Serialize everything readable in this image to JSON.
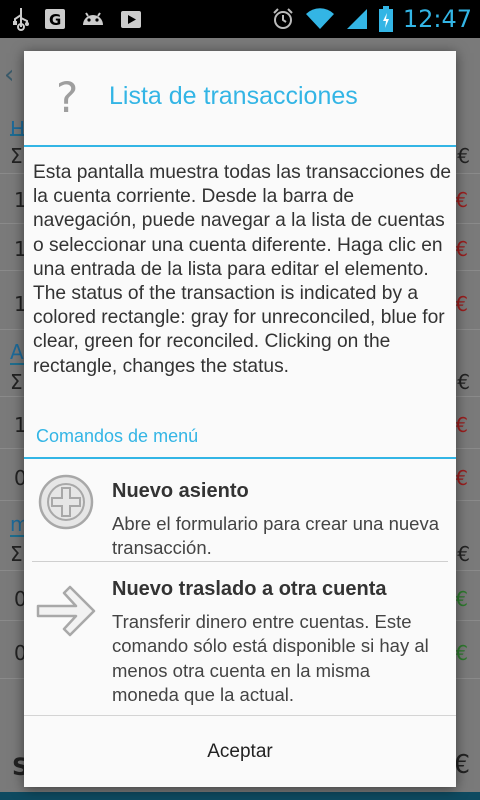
{
  "status_bar": {
    "time": "12:47",
    "icons": [
      "usb-icon",
      "g-icon",
      "android-icon",
      "play-store-icon",
      "alarm-icon",
      "wifi-icon",
      "signal-icon",
      "battery-icon"
    ]
  },
  "background": {
    "rows": [
      {
        "left": "Σ",
        "right": "€"
      },
      {
        "left": "1",
        "right": "€"
      },
      {
        "left": "1",
        "right": "€"
      },
      {
        "left": "1",
        "right": "€"
      },
      {
        "left": "A",
        "right": ""
      },
      {
        "left": "Σ",
        "right": "€"
      },
      {
        "left": "1",
        "right": "€"
      },
      {
        "left": "0",
        "right": "€"
      },
      {
        "left": "m",
        "right": ""
      },
      {
        "left": "Σ",
        "right": "€"
      },
      {
        "left": "0",
        "right": "€"
      },
      {
        "left": "0",
        "right": "€"
      },
      {
        "left": "S",
        "right": "€"
      }
    ]
  },
  "dialog": {
    "title": "Lista de transacciones",
    "body": "Esta pantalla muestra todas las transacciones de la cuenta corriente. Desde la barra de navegación, puede navegar a la lista de cuentas o seleccionar una cuenta diferente. Haga clic en una entrada de la lista para editar el elemento.\nThe status of the transaction is indicated by a colored rectangle: gray for unreconciled, blue for clear, green for reconciled. Clicking on the rectangle, changes the status.",
    "section_title": "Comandos de menú",
    "commands": [
      {
        "title": "Nuevo asiento",
        "description": "Abre el formulario para crear una nueva transacción."
      },
      {
        "title": "Nuevo traslado a otra cuenta",
        "description": "Transferir dinero entre cuentas. Este comando sólo está disponible si hay al menos otra cuenta en la misma moneda que la actual."
      }
    ],
    "accept_label": "Aceptar"
  },
  "colors": {
    "accent": "#33b5e5",
    "text": "#333333"
  }
}
